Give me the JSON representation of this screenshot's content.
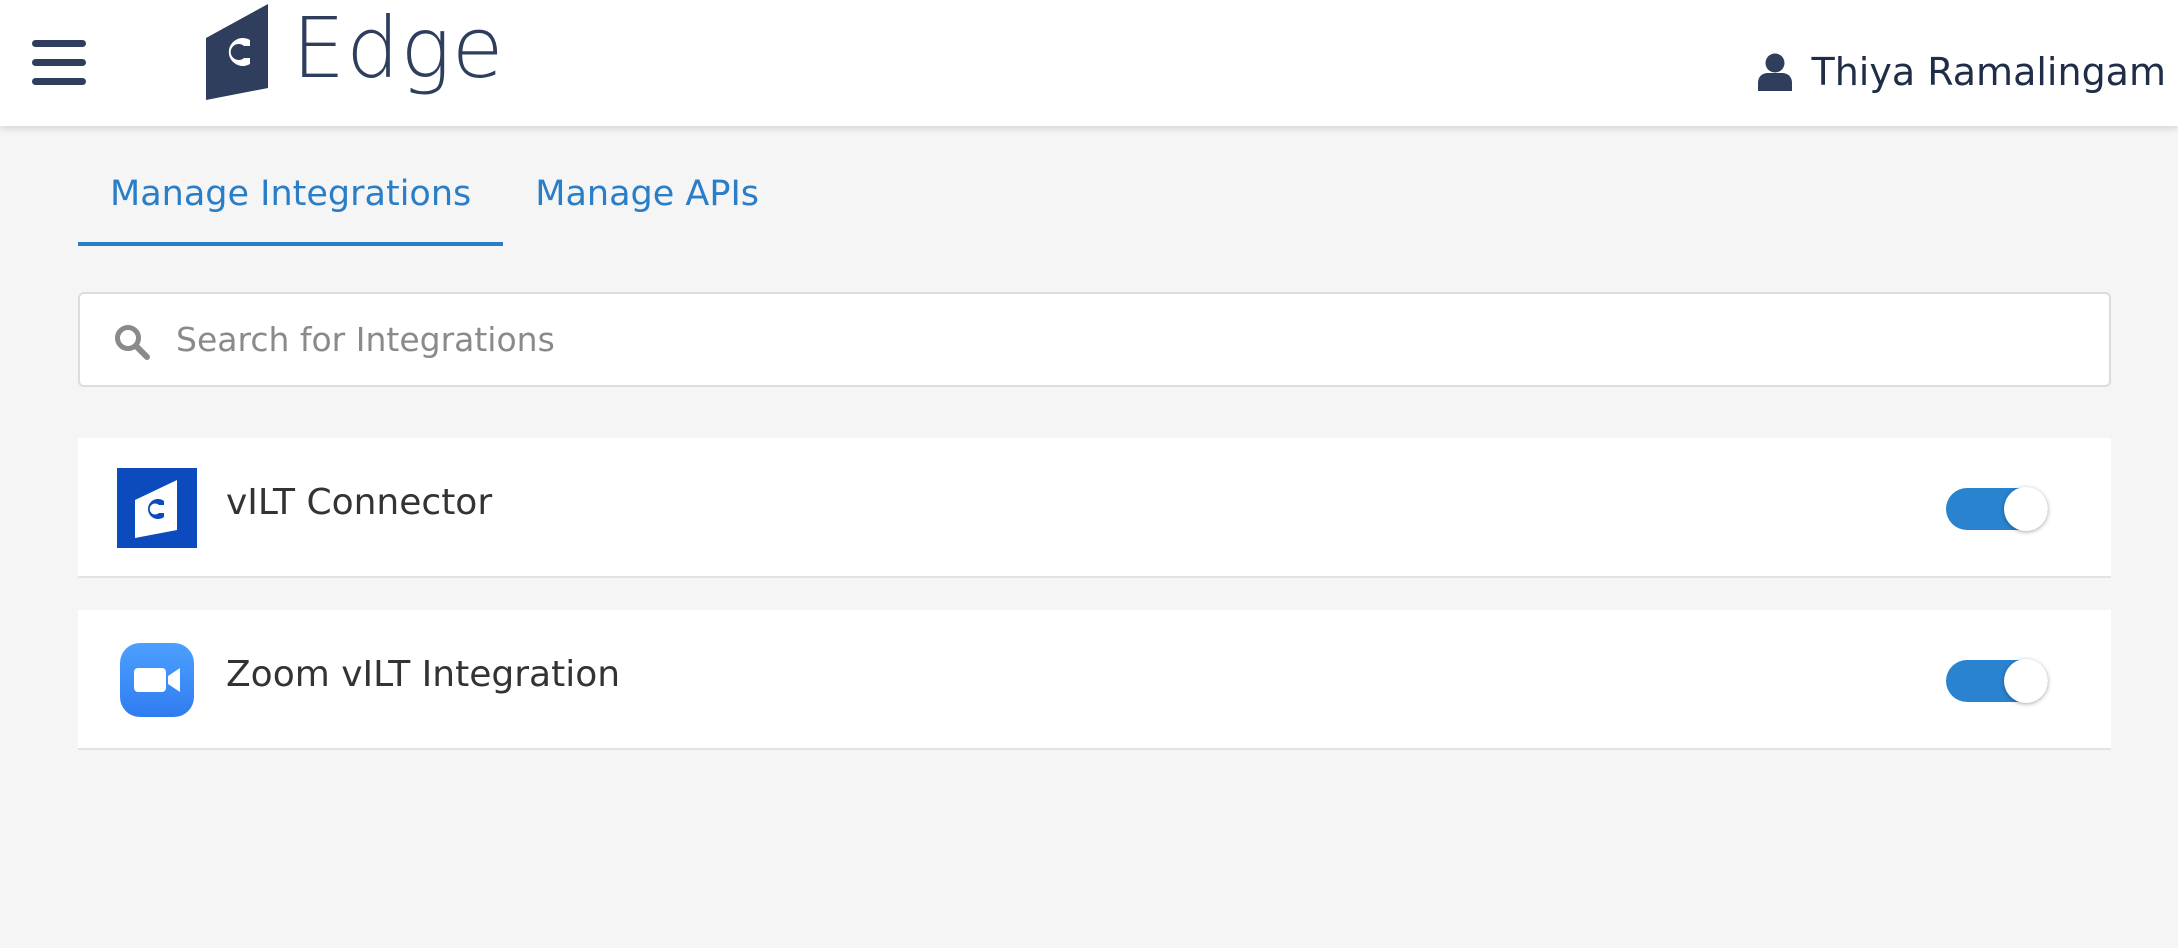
{
  "header": {
    "brand_name": "Edge",
    "user_name": "Thiya Ramalingam",
    "brand_color": "#2e3e5c"
  },
  "tabs": [
    {
      "label": "Manage Integrations",
      "active": true
    },
    {
      "label": "Manage APIs",
      "active": false
    }
  ],
  "search": {
    "placeholder": "Search for Integrations",
    "value": ""
  },
  "integrations": [
    {
      "name": "vILT Connector",
      "icon": "edge-logo-icon",
      "enabled": true
    },
    {
      "name": "Zoom vILT Integration",
      "icon": "zoom-video-icon",
      "enabled": true
    }
  ],
  "colors": {
    "accent": "#2a7ec8",
    "toggle_on": "#2a83cf",
    "edge_blue": "#0b4bbd",
    "zoom_blue": "#3f8cf8"
  }
}
